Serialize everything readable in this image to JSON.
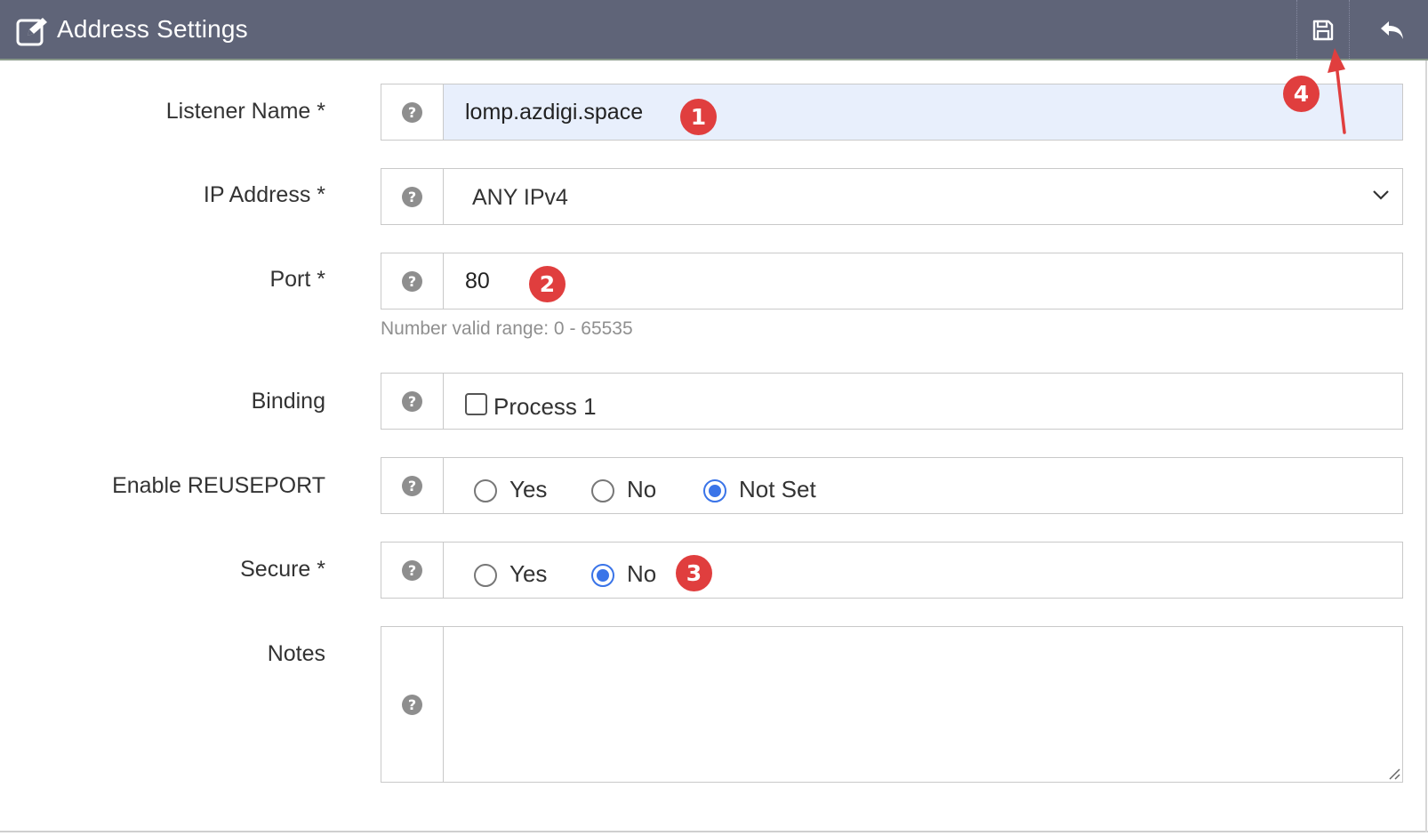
{
  "header": {
    "title": "Address Settings",
    "icons": {
      "title": "edit-icon",
      "save": "save-icon",
      "back": "undo-icon"
    }
  },
  "form": {
    "listener_name": {
      "label": "Listener Name *",
      "value": "lomp.azdigi.space"
    },
    "ip_address": {
      "label": "IP Address *",
      "selected": "ANY IPv4"
    },
    "port": {
      "label": "Port *",
      "value": "80",
      "hint": "Number valid range: 0 - 65535"
    },
    "binding": {
      "label": "Binding",
      "checkbox_label": "Process 1",
      "checked": false
    },
    "reuseport": {
      "label": "Enable REUSEPORT",
      "options": [
        "Yes",
        "No",
        "Not Set"
      ],
      "selected": "Not Set"
    },
    "secure": {
      "label": "Secure *",
      "options": [
        "Yes",
        "No"
      ],
      "selected": "No"
    },
    "notes": {
      "label": "Notes",
      "value": ""
    },
    "help_glyph": "?"
  },
  "annotations": {
    "badges": [
      "1",
      "2",
      "3",
      "4"
    ],
    "color": "#e03e3e"
  },
  "colors": {
    "header_bg": "#5f6478",
    "filled_input_bg": "#e8effc",
    "radio_accent": "#3a74e8"
  }
}
